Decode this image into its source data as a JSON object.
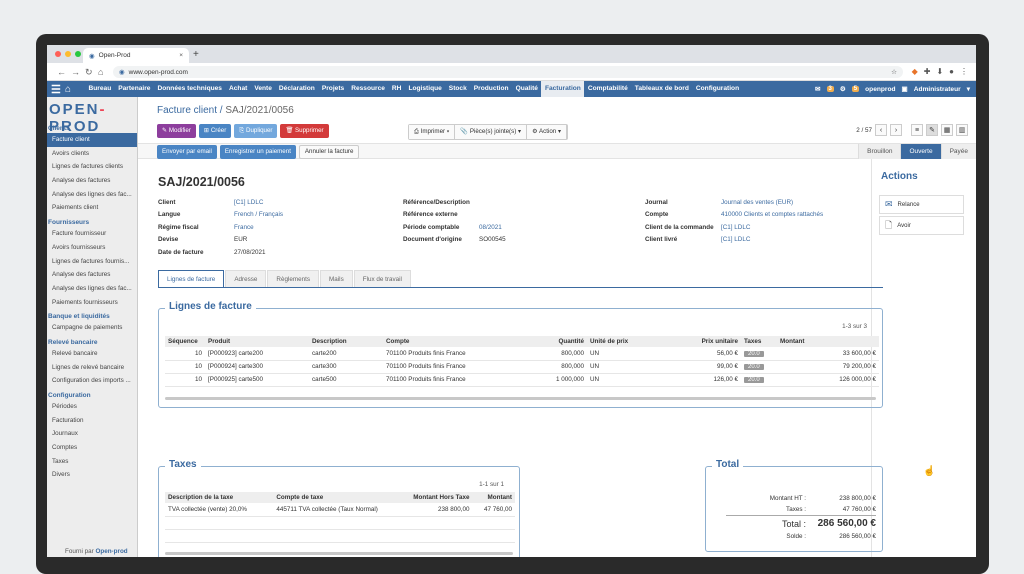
{
  "browser": {
    "tab_title": "Open-Prod",
    "url": "www.open-prod.com"
  },
  "menu": [
    "Bureau",
    "Partenaire",
    "Données techniques",
    "Achat",
    "Vente",
    "Déclaration",
    "Projets",
    "Ressource",
    "RH",
    "Logistique",
    "Stock",
    "Production",
    "Qualité",
    "Facturation",
    "Comptabilité",
    "Tableaux de bord",
    "Configuration"
  ],
  "topright": {
    "messages_count": "3",
    "activities_count": "5",
    "db": "openprod",
    "user": "Administrateur"
  },
  "sidebar": {
    "sections": [
      {
        "title": "Clients",
        "items": [
          "Facture client",
          "Avoirs clients",
          "Lignes de factures clients",
          "Analyse des factures",
          "Analyse des lignes des fac...",
          "Paiements client"
        ]
      },
      {
        "title": "Fournisseurs",
        "items": [
          "Facture fournisseur",
          "Avoirs fournisseurs",
          "Lignes de factures fournis...",
          "Analyse des factures",
          "Analyse des lignes des fac...",
          "Paiements fournisseurs"
        ]
      },
      {
        "title": "Banque et liquidités",
        "items": [
          "Campagne de paiements"
        ]
      },
      {
        "title": "Relevé bancaire",
        "items": [
          "Relevé bancaire",
          "Lignes de relevé bancaire",
          "Configuration des imports ..."
        ]
      },
      {
        "title": "Configuration",
        "items": [
          "Périodes",
          "Facturation",
          "Journaux",
          "Comptes",
          "Taxes",
          "Divers"
        ]
      }
    ],
    "footer_prefix": "Fourni par",
    "footer_link": "Open-prod"
  },
  "breadcrumb": [
    "Facture client",
    "SAJ/2021/0056"
  ],
  "buttons": {
    "modifier": "Modifier",
    "creer": "Créer",
    "dupliquer": "Dupliquer",
    "supprimer": "Supprimer",
    "imprimer": "Imprimer",
    "pieces_jointes": "Pièce(s) jointe(s)",
    "action": "Action"
  },
  "pager": {
    "value": "2 / 57"
  },
  "workflow": {
    "envoyer_email": "Envoyer par email",
    "enregistrer_paiement": "Enregistrer un paiement",
    "annuler": "Annuler la facture"
  },
  "stages": [
    "Brouillon",
    "Ouverte",
    "Payée"
  ],
  "form": {
    "title": "SAJ/2021/0056",
    "left": [
      {
        "label": "Client",
        "value": "[C1] LDLC"
      },
      {
        "label": "Langue",
        "value": "French / Français"
      },
      {
        "label": "Régime fiscal",
        "value": "France"
      },
      {
        "label": "Devise",
        "value": "EUR"
      },
      {
        "label": "Date de facture",
        "value": "27/08/2021"
      }
    ],
    "middle": [
      {
        "label": "Référence/Description",
        "value": ""
      },
      {
        "label": "Référence externe",
        "value": ""
      },
      {
        "label": "Période comptable",
        "value": "08/2021"
      },
      {
        "label": "Document d'origine",
        "value": "SO00545"
      }
    ],
    "right": [
      {
        "label": "Journal",
        "value": "Journal des ventes (EUR)"
      },
      {
        "label": "Compte",
        "value": "410000 Clients et comptes rattachés"
      },
      {
        "label": "Client de la commande",
        "value": "[C1] LDLC"
      },
      {
        "label": "Client livré",
        "value": "[C1] LDLC"
      }
    ]
  },
  "tabs": [
    "Lignes de facture",
    "Adresse",
    "Règlements",
    "Mails",
    "Flux de travail"
  ],
  "lines": {
    "legend": "Lignes de facture",
    "count": "1-3 sur 3",
    "headers": [
      "Séquence",
      "Produit",
      "Description",
      "Compte",
      "Quantité",
      "Unité de prix",
      "Prix unitaire",
      "Taxes",
      "Montant"
    ],
    "rows": [
      [
        "10",
        "[P000923] carte200",
        "carte200",
        "701100 Produits finis France",
        "800,000",
        "UN",
        "56,00 €",
        "20.0",
        "33 600,00 €"
      ],
      [
        "10",
        "[P000924] carte300",
        "carte300",
        "701100 Produits finis France",
        "800,000",
        "UN",
        "99,00 €",
        "20.0",
        "79 200,00 €"
      ],
      [
        "10",
        "[P000925] carte500",
        "carte500",
        "701100 Produits finis France",
        "1 000,000",
        "UN",
        "126,00 €",
        "20.0",
        "126 000,00 €"
      ]
    ]
  },
  "taxes": {
    "legend": "Taxes",
    "count": "1-1 sur 1",
    "headers": [
      "Description de la taxe",
      "Compte de taxe",
      "Montant Hors Taxe",
      "Montant"
    ],
    "rows": [
      [
        "TVA collectée (vente) 20,0%",
        "445711 TVA collectée (Taux Normal)",
        "238 800,00",
        "47 760,00"
      ]
    ]
  },
  "totals": {
    "legend": "Total",
    "rows": [
      {
        "label": "Montant HT :",
        "value": "238 800,00 €"
      },
      {
        "label": "Taxes :",
        "value": "47 760,00 €"
      },
      {
        "label": "Total :",
        "value": "286 560,00 €"
      },
      {
        "label": "Solde :",
        "value": "286 560,00 €"
      }
    ]
  },
  "actions": {
    "title": "Actions",
    "items": [
      "Relance",
      "Avoir"
    ]
  }
}
